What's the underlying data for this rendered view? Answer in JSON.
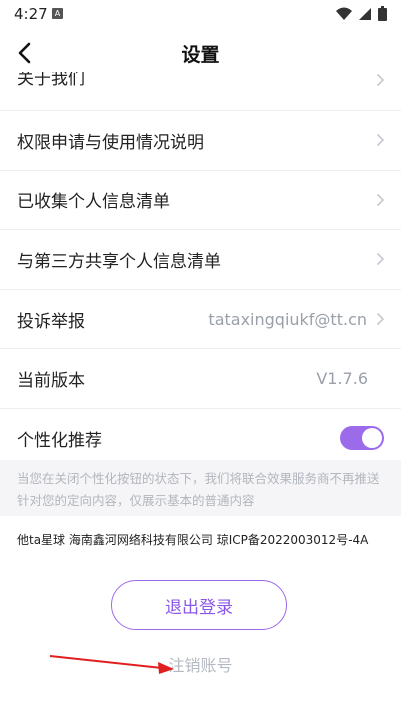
{
  "status_bar": {
    "time": "4:27",
    "notification_badge": "A",
    "icons": [
      "wifi-icon",
      "signal-icon",
      "battery-icon"
    ]
  },
  "header": {
    "title": "设置",
    "back_icon": "chevron-left-icon"
  },
  "settings": {
    "items": [
      {
        "label": "关于我们",
        "value": "",
        "icon": "chevron-right-icon"
      },
      {
        "label": "权限申请与使用情况说明",
        "value": "",
        "icon": "chevron-right-icon"
      },
      {
        "label": "已收集个人信息清单",
        "value": "",
        "icon": "chevron-right-icon"
      },
      {
        "label": "与第三方共享个人信息清单",
        "value": "",
        "icon": "chevron-right-icon"
      },
      {
        "label": "投诉举报",
        "value": "tataxingqiukf@tt.cn",
        "icon": "chevron-right-icon"
      },
      {
        "label": "当前版本",
        "value": "V1.7.6",
        "icon": ""
      },
      {
        "label": "个性化推荐",
        "value": "",
        "toggle_on": true
      }
    ]
  },
  "note": {
    "text": "当您在关闭个性化按钮的状态下，我们将联合效果服务商不再推送针对您的定向内容，仅展示基本的普通内容"
  },
  "footer": {
    "icp": "他ta星球 海南鑫河网络科技有限公司 琼ICP备2022003012号-4A",
    "logout_label": "退出登录",
    "cancel_account_label": "注销账号"
  },
  "colors": {
    "accent": "#9b6bea",
    "muted_text": "#9aa0aa",
    "annotation_arrow": "#e02020"
  }
}
